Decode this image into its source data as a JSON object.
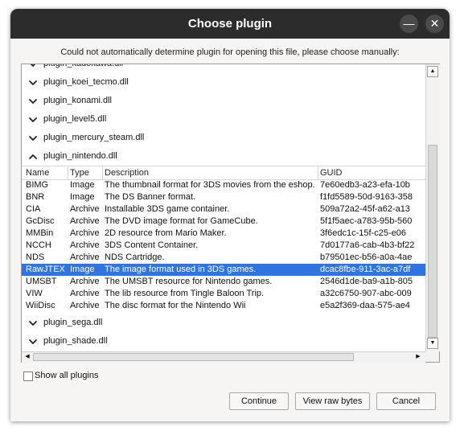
{
  "window": {
    "title": "Choose plugin"
  },
  "title_buttons": {
    "minimize": "—",
    "close": "✕"
  },
  "message": "Could not automatically determine plugin for opening this file, please choose manually:",
  "tree": {
    "nodes_top": [
      {
        "label": "plugin_kadokawa.dll",
        "expanded": false
      },
      {
        "label": "plugin_koei_tecmo.dll",
        "expanded": false
      },
      {
        "label": "plugin_konami.dll",
        "expanded": false
      },
      {
        "label": "plugin_level5.dll",
        "expanded": false
      },
      {
        "label": "plugin_mercury_steam.dll",
        "expanded": false
      },
      {
        "label": "plugin_nintendo.dll",
        "expanded": true
      }
    ],
    "nodes_bottom": [
      {
        "label": "plugin_sega.dll",
        "expanded": false
      },
      {
        "label": "plugin_shade.dll",
        "expanded": false
      }
    ]
  },
  "table": {
    "columns": [
      "Name",
      "Type",
      "Description",
      "GUID"
    ],
    "selected_index": 7,
    "rows": [
      [
        "BIMG",
        "Image",
        "The thumbnail format for 3DS movies from the eshop.",
        "7e60edb3-a23-efa-10b"
      ],
      [
        "BNR",
        "Image",
        "The DS Banner format.",
        "f1fd5589-50d-9163-358"
      ],
      [
        "CIA",
        "Archive",
        "Installable 3DS game container.",
        "509a72a2-45f-a62-a13"
      ],
      [
        "GcDisc",
        "Archive",
        "The DVD image format for GameCube.",
        "5f1f5aec-a783-95b-560"
      ],
      [
        "MMBin",
        "Archive",
        "2D resource from Mario Maker.",
        "3f6edc1c-15f-c25-e06"
      ],
      [
        "NCCH",
        "Archive",
        "3DS Content Container.",
        "7d0177a6-cab-4b3-bf22"
      ],
      [
        "NDS",
        "Archive",
        "NDS Cartridge.",
        "b79501ec-b56-a0a-4ae"
      ],
      [
        "RawJTEX",
        "Image",
        "The image format used in 3DS games.",
        "dcac8fbe-911-3ac-a7df"
      ],
      [
        "UMSBT",
        "Archive",
        "The UMSBT resource for Nintendo games.",
        "2546d1de-ba9-a1b-805"
      ],
      [
        "VIW",
        "Archive",
        "The lib resource from Tingle Baloon Trip.",
        "a32c6750-907-abc-009"
      ],
      [
        "WiiDisc",
        "Archive",
        "The disc format for the Nintendo Wii",
        "e5a2f369-daa-575-ae4"
      ]
    ]
  },
  "scroll_arrows": {
    "up": "▲",
    "down": "▼",
    "left": "◀",
    "right": "▶"
  },
  "checkbox": {
    "label": "Show all plugins",
    "checked": false
  },
  "buttons": {
    "continue": "Continue",
    "view_raw": "View raw bytes",
    "cancel": "Cancel"
  },
  "colors": {
    "titlebar": "#2c2c2c",
    "selection": "#2f74e0"
  }
}
